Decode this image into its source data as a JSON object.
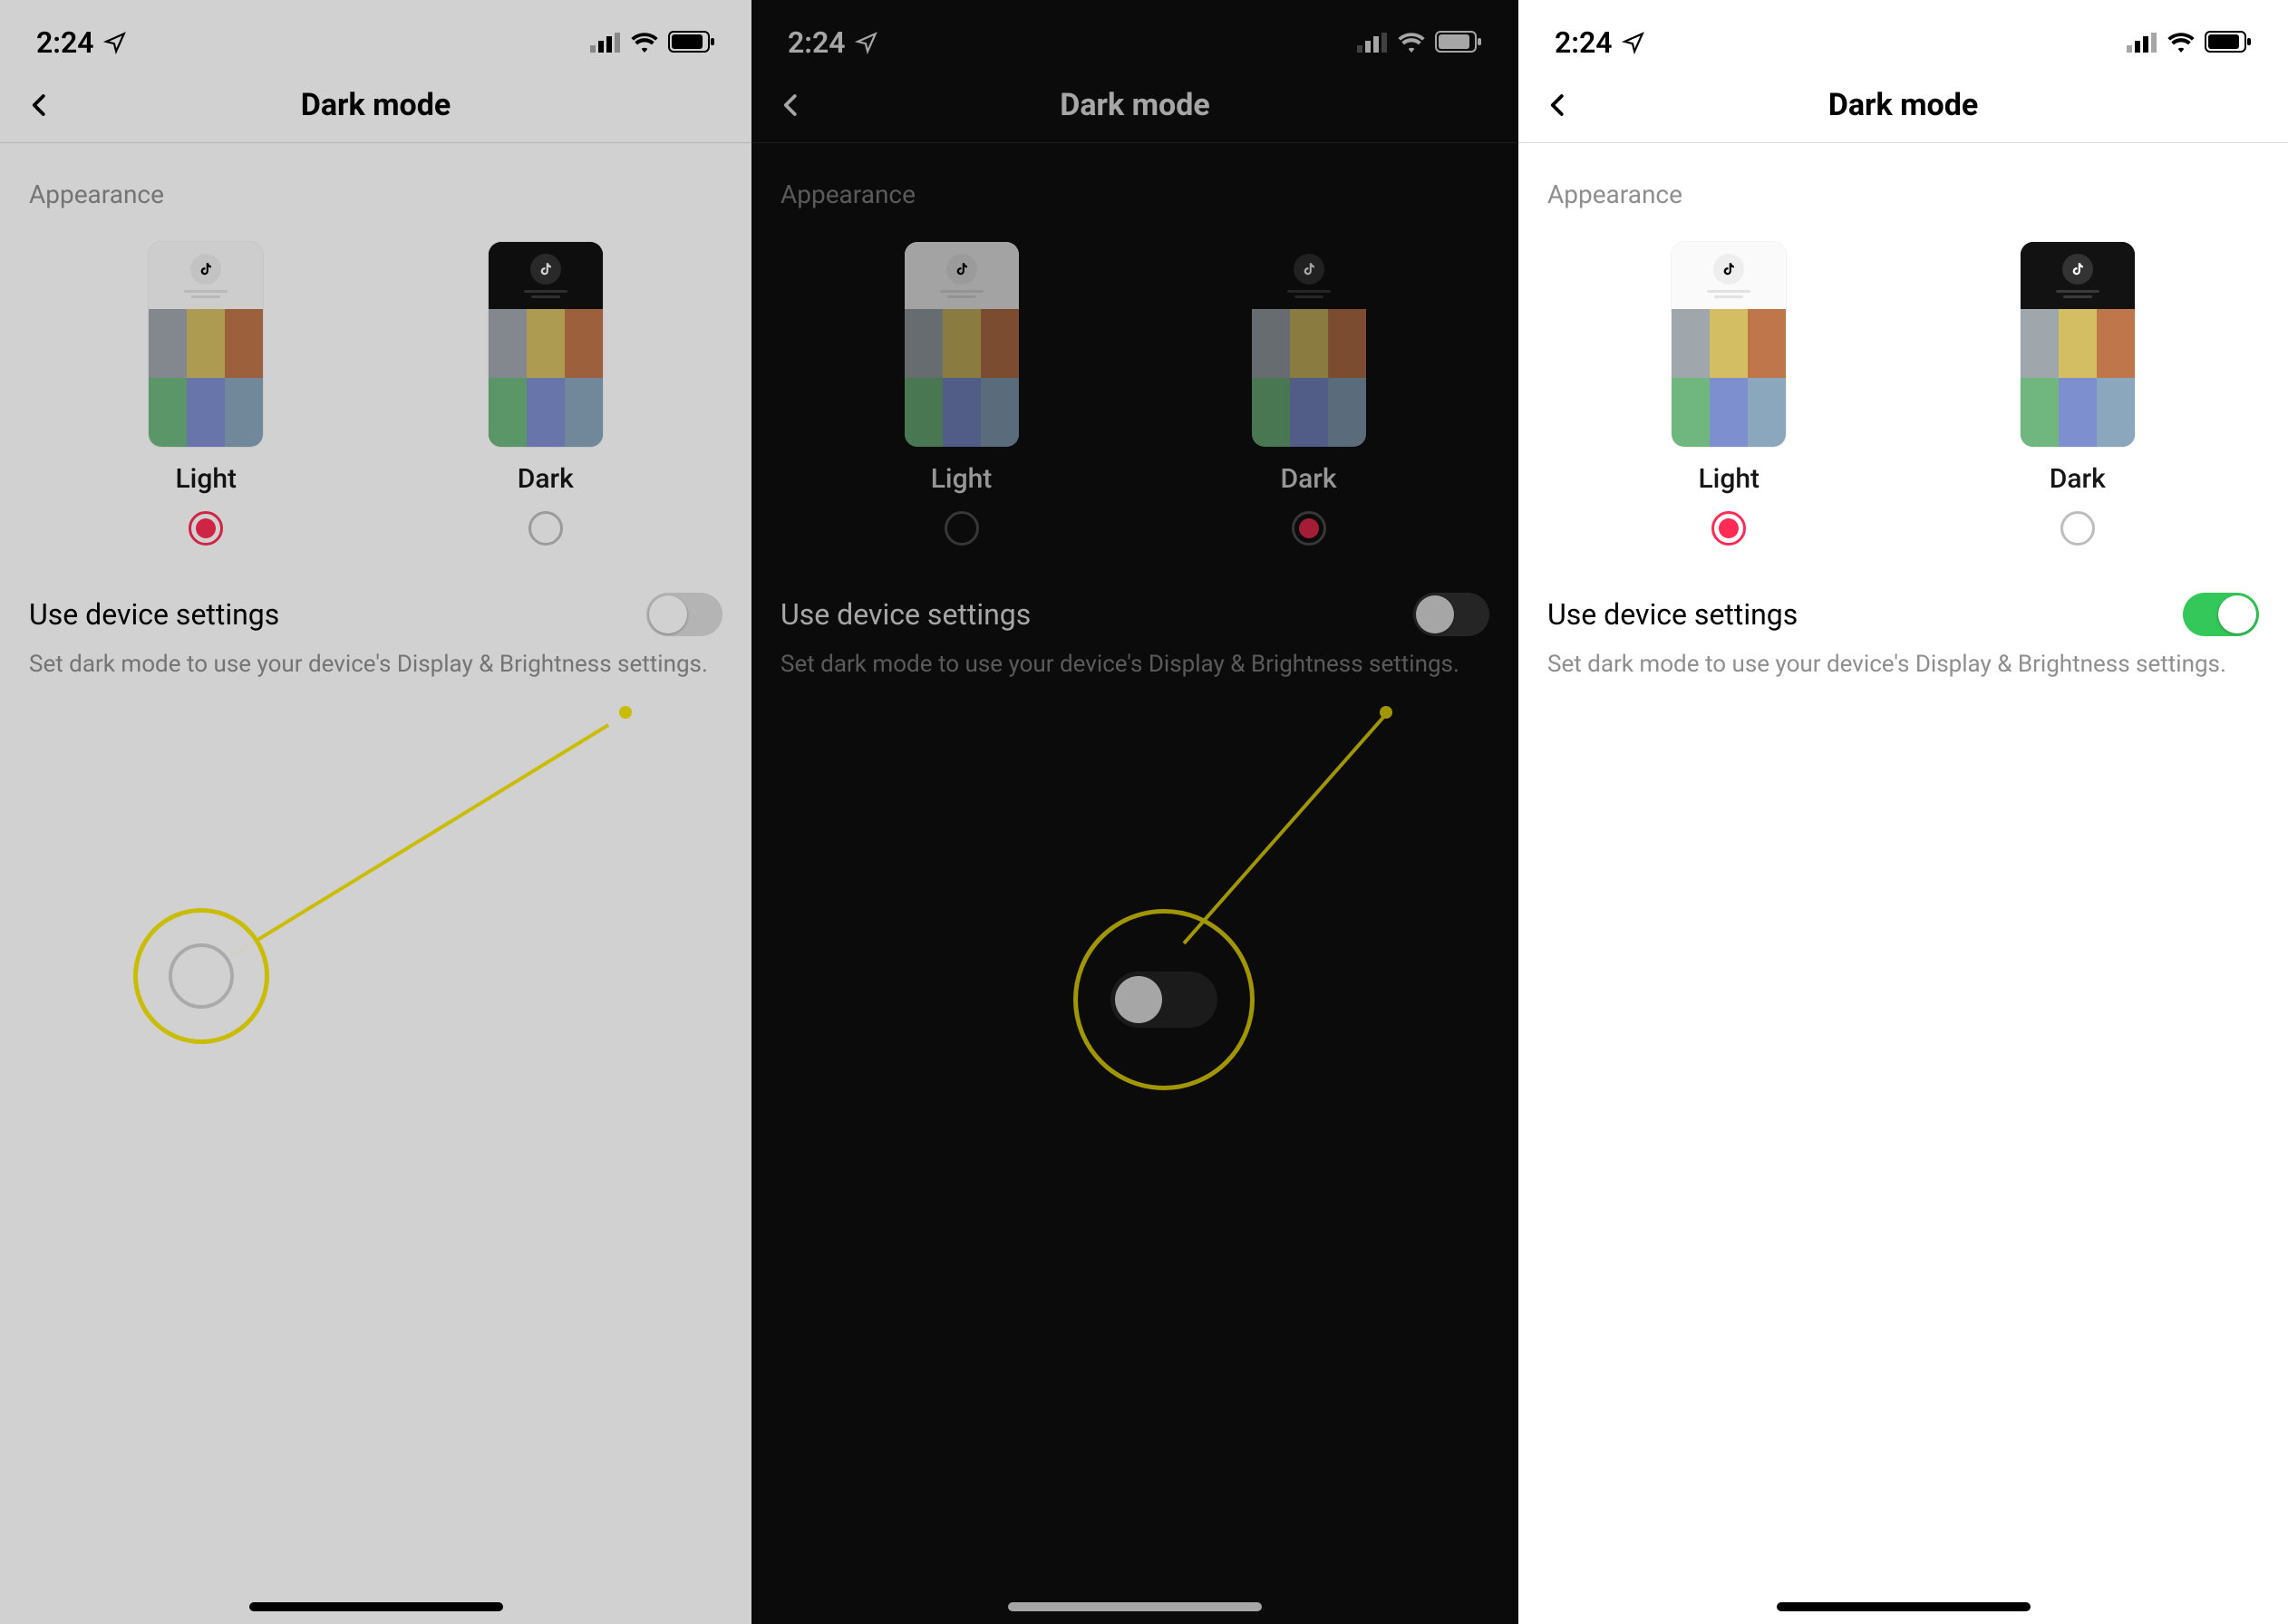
{
  "status": {
    "time": "2:24",
    "location_icon": "location-arrow",
    "signal": "signal-3",
    "wifi": "wifi",
    "battery": "battery"
  },
  "header": {
    "title": "Dark mode"
  },
  "section": {
    "appearance_label": "Appearance"
  },
  "themes": {
    "light_label": "Light",
    "dark_label": "Dark"
  },
  "device_setting": {
    "label": "Use device settings",
    "description": "Set dark mode to use your device's Display & Brightness settings."
  },
  "panels": [
    {
      "mode": "light",
      "dimmed": true,
      "selected_theme": "light",
      "device_toggle": "off",
      "callout": "circle"
    },
    {
      "mode": "dark",
      "dimmed": true,
      "selected_theme": "dark",
      "device_toggle": "off",
      "callout": "toggle"
    },
    {
      "mode": "light",
      "dimmed": false,
      "selected_theme": "light",
      "device_toggle": "on",
      "callout": null
    }
  ],
  "layout": {
    "panel_widths": [
      829,
      846,
      849
    ]
  },
  "colors": {
    "accent": "#fe2c55",
    "toggle_on": "#34c759",
    "callout": "#f7e600"
  }
}
